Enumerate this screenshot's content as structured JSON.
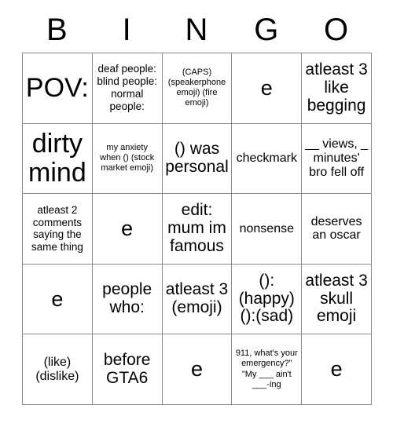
{
  "card": {
    "header_letters": [
      "B",
      "I",
      "N",
      "G",
      "O"
    ],
    "rows": [
      [
        {
          "text": "POV:",
          "size": "fs-xxl"
        },
        {
          "text": "deaf people: blind people: normal people:",
          "size": "fs-s"
        },
        {
          "text": "(CAPS) (speakerphone emoji) (fire emoji)",
          "size": "fs-xs"
        },
        {
          "text": "e",
          "size": "fs-xl"
        },
        {
          "text": "atleast 3 like begging",
          "size": "fs-l"
        }
      ],
      [
        {
          "text": "dirty mind",
          "size": "fs-xxl"
        },
        {
          "text": "my anxiety when () (stock market emoji)",
          "size": "fs-xs"
        },
        {
          "text": "() was personal",
          "size": "fs-l"
        },
        {
          "text": "checkmark",
          "size": "fs-m"
        },
        {
          "text": "__ views, _ minutes' bro fell off",
          "size": "fs-m"
        }
      ],
      [
        {
          "text": "atleast 2 comments saying the same thing",
          "size": "fs-s"
        },
        {
          "text": "e",
          "size": "fs-xl"
        },
        {
          "text": "edit: mum im famous",
          "size": "fs-l"
        },
        {
          "text": "nonsense",
          "size": "fs-m"
        },
        {
          "text": "deserves an oscar",
          "size": "fs-m"
        }
      ],
      [
        {
          "text": "e",
          "size": "fs-xl"
        },
        {
          "text": "people who:",
          "size": "fs-l"
        },
        {
          "text": "atleast 3 (emoji)",
          "size": "fs-l"
        },
        {
          "text": "(): (happy) ():(sad)",
          "size": "fs-l"
        },
        {
          "text": "atleast 3 skull emoji",
          "size": "fs-l"
        }
      ],
      [
        {
          "text": "(like) (dislike)",
          "size": "fs-m"
        },
        {
          "text": "before GTA6",
          "size": "fs-l"
        },
        {
          "text": "e",
          "size": "fs-xl"
        },
        {
          "text": "911, what's your emergency?\" \"My ___ ain't ___-ing",
          "size": "fs-xs"
        },
        {
          "text": "e",
          "size": "fs-xl"
        }
      ]
    ]
  },
  "colors": {
    "border": "#8a8a8a",
    "text": "#000000",
    "background": "#ffffff"
  }
}
